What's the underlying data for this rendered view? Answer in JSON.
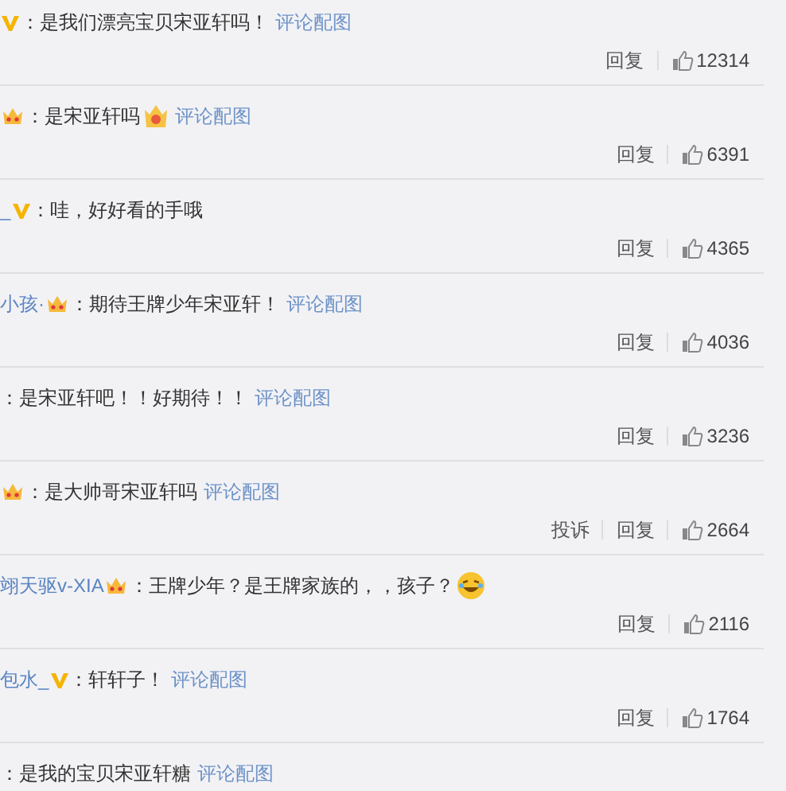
{
  "comments": [
    {
      "badge": {
        "kind": "vip"
      },
      "text": "：是我们漂亮宝贝宋亚轩吗！",
      "link": "评论配图",
      "actions": [
        "回复"
      ],
      "likes": "12314"
    },
    {
      "badge": {
        "kind": "crown"
      },
      "text": "：是宋亚轩吗",
      "sticker": {
        "kind": "crown-face"
      },
      "link": "评论配图",
      "actions": [
        "回复"
      ],
      "likes": "6391"
    },
    {
      "user": "_",
      "badge": {
        "kind": "vip"
      },
      "text": "：哇，好好看的手哦",
      "actions": [
        "回复"
      ],
      "likes": "4365"
    },
    {
      "user": "小孩·",
      "badge": {
        "kind": "crown"
      },
      "text": "：期待王牌少年宋亚轩！",
      "link": "评论配图",
      "actions": [
        "回复"
      ],
      "likes": "4036"
    },
    {
      "text": "：是宋亚轩吧！！好期待！！",
      "link": "评论配图",
      "actions": [
        "回复"
      ],
      "likes": "3236"
    },
    {
      "badge": {
        "kind": "crown"
      },
      "text": "：是大帅哥宋亚轩吗",
      "link": "评论配图",
      "actions": [
        "投诉",
        "回复"
      ],
      "likes": "2664"
    },
    {
      "user": "翊天驱v-XIA",
      "badge": {
        "kind": "crown"
      },
      "text": "：王牌少年？是王牌家族的，，孩子？",
      "sticker": {
        "kind": "laugh"
      },
      "actions": [
        "回复"
      ],
      "likes": "2116"
    },
    {
      "user": "包水_",
      "badge": {
        "kind": "vip"
      },
      "text": "：轩轩子！",
      "link": "评论配图",
      "actions": [
        "回复"
      ],
      "likes": "1764"
    },
    {
      "text": "：是我的宝贝宋亚轩糖",
      "link": "评论配图"
    }
  ]
}
